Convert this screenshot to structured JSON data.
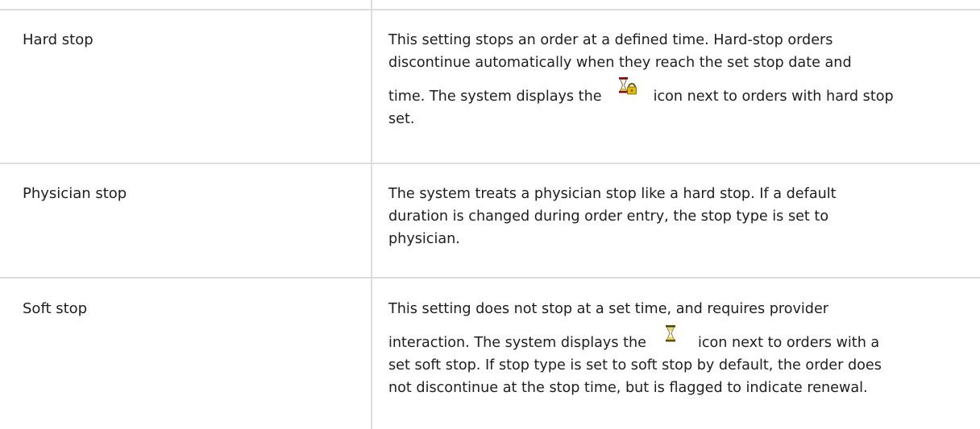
{
  "table": {
    "rows": [
      {
        "term": "Hard stop",
        "desc_1": "This setting stops an order at a defined time. Hard-stop orders",
        "desc_2": "discontinue automatically when they reach the set stop date and",
        "desc_3a": "time. The system displays the",
        "desc_3b": "icon next to orders with hard stop",
        "desc_4": "set.",
        "icon": "hourglass-lock-icon"
      },
      {
        "term": "Physician stop",
        "desc_1": "The system treats a physician stop like a hard stop. If a default",
        "desc_2": "duration is changed during order entry, the stop type is set to",
        "desc_3": "physician."
      },
      {
        "term": "Soft stop",
        "desc_1": "This setting does not stop at a set time, and requires provider",
        "desc_2a": "interaction. The system displays the",
        "desc_2b": "icon next to orders with a",
        "desc_3": "set soft stop. If stop type is set to soft stop by default, the order does",
        "desc_4": "not discontinue at the stop time, but is flagged to indicate renewal.",
        "icon": "hourglass-icon"
      }
    ]
  },
  "colors": {
    "text": "#1e1e1e",
    "border": "#dcdcdc",
    "hourglass_frame": "#8b0000",
    "hourglass_sand": "#e8d84a",
    "lock": "#e5b800"
  }
}
